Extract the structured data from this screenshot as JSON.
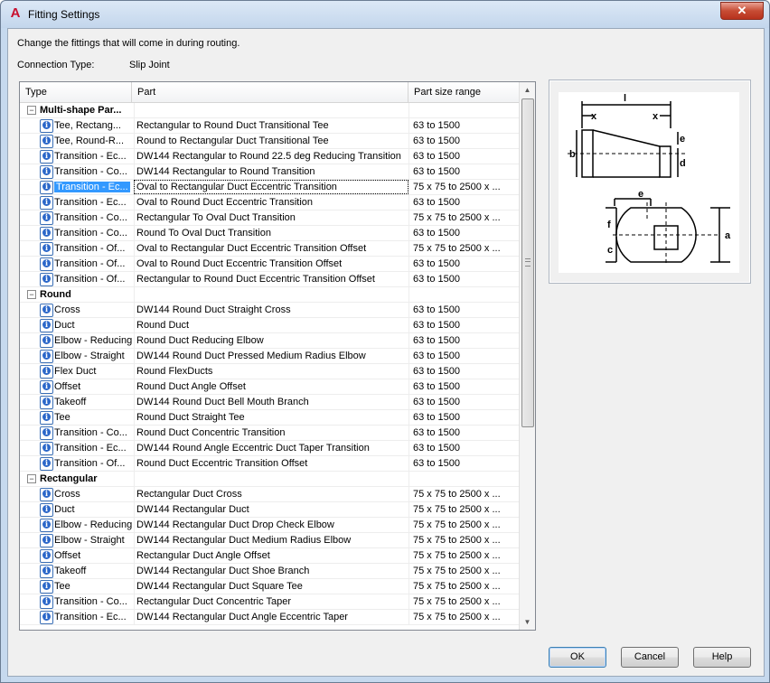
{
  "window": {
    "title": "Fitting Settings",
    "close_glyph": "✕"
  },
  "description": "Change the fittings that will come in during routing.",
  "connection": {
    "label": "Connection Type:",
    "value": "Slip Joint"
  },
  "columns": [
    "Type",
    "Part",
    "Part size range"
  ],
  "rows": [
    {
      "kind": "group",
      "type": "Multi-shape Par..."
    },
    {
      "kind": "item",
      "type": "Tee, Rectang...",
      "part": "Rectangular to Round Duct Transitional Tee",
      "size": "63 to 1500"
    },
    {
      "kind": "item",
      "type": "Tee, Round-R...",
      "part": "Round to Rectangular Duct Transitional Tee",
      "size": "63 to 1500"
    },
    {
      "kind": "item",
      "type": "Transition - Ec...",
      "part": "DW144 Rectangular to Round 22.5 deg Reducing Transition",
      "size": "63 to 1500"
    },
    {
      "kind": "item",
      "type": "Transition - Co...",
      "part": "DW144 Rectangular to Round Transition",
      "size": "63 to 1500"
    },
    {
      "kind": "item",
      "type": "Transition - Ec...",
      "part": "Oval to Rectangular Duct Eccentric Transition",
      "size": "75 x 75 to 2500 x ...",
      "selected": true
    },
    {
      "kind": "item",
      "type": "Transition - Ec...",
      "part": "Oval to Round Duct Eccentric Transition",
      "size": "63 to 1500"
    },
    {
      "kind": "item",
      "type": "Transition - Co...",
      "part": "Rectangular To Oval Duct Transition",
      "size": "75 x 75 to 2500 x ..."
    },
    {
      "kind": "item",
      "type": "Transition - Co...",
      "part": "Round To Oval Duct Transition",
      "size": "63 to 1500"
    },
    {
      "kind": "item",
      "type": "Transition - Of...",
      "part": "Oval to Rectangular Duct Eccentric Transition Offset",
      "size": "75 x 75 to 2500 x ..."
    },
    {
      "kind": "item",
      "type": "Transition - Of...",
      "part": "Oval to Round Duct Eccentric Transition Offset",
      "size": "63 to 1500"
    },
    {
      "kind": "item",
      "type": "Transition - Of...",
      "part": "Rectangular to Round Duct Eccentric Transition Offset",
      "size": "63 to 1500"
    },
    {
      "kind": "group",
      "type": "Round"
    },
    {
      "kind": "item",
      "type": "Cross",
      "part": "DW144 Round Duct Straight Cross",
      "size": "63 to 1500"
    },
    {
      "kind": "item",
      "type": "Duct",
      "part": "Round Duct",
      "size": "63 to 1500"
    },
    {
      "kind": "item",
      "type": "Elbow - Reducing",
      "part": "Round Duct Reducing Elbow",
      "size": "63 to 1500"
    },
    {
      "kind": "item",
      "type": "Elbow - Straight",
      "part": "DW144 Round Duct Pressed Medium Radius Elbow",
      "size": "63 to 1500"
    },
    {
      "kind": "item",
      "type": "Flex Duct",
      "part": "Round FlexDucts",
      "size": "63 to 1500"
    },
    {
      "kind": "item",
      "type": "Offset",
      "part": "Round Duct Angle Offset",
      "size": "63 to 1500"
    },
    {
      "kind": "item",
      "type": "Takeoff",
      "part": "DW144 Round Duct Bell Mouth Branch",
      "size": "63 to 1500"
    },
    {
      "kind": "item",
      "type": "Tee",
      "part": "Round Duct Straight Tee",
      "size": "63 to 1500"
    },
    {
      "kind": "item",
      "type": "Transition - Co...",
      "part": "Round Duct Concentric Transition",
      "size": "63 to 1500"
    },
    {
      "kind": "item",
      "type": "Transition - Ec...",
      "part": "DW144 Round Angle Eccentric Duct Taper Transition",
      "size": "63 to 1500"
    },
    {
      "kind": "item",
      "type": "Transition - Of...",
      "part": "Round Duct Eccentric Transition Offset",
      "size": "63 to 1500"
    },
    {
      "kind": "group",
      "type": "Rectangular"
    },
    {
      "kind": "item",
      "type": "Cross",
      "part": "Rectangular Duct Cross",
      "size": "75 x 75 to 2500 x ..."
    },
    {
      "kind": "item",
      "type": "Duct",
      "part": "DW144 Rectangular Duct",
      "size": "75 x 75 to 2500 x ..."
    },
    {
      "kind": "item",
      "type": "Elbow - Reducing",
      "part": "DW144 Rectangular Duct Drop Check Elbow",
      "size": "75 x 75 to 2500 x ..."
    },
    {
      "kind": "item",
      "type": "Elbow - Straight",
      "part": "DW144 Rectangular Duct Medium Radius Elbow",
      "size": "75 x 75 to 2500 x ..."
    },
    {
      "kind": "item",
      "type": "Offset",
      "part": "Rectangular Duct Angle Offset",
      "size": "75 x 75 to 2500 x ..."
    },
    {
      "kind": "item",
      "type": "Takeoff",
      "part": "DW144 Rectangular Duct Shoe Branch",
      "size": "75 x 75 to 2500 x ..."
    },
    {
      "kind": "item",
      "type": "Tee",
      "part": "DW144 Rectangular Duct Square Tee",
      "size": "75 x 75 to 2500 x ..."
    },
    {
      "kind": "item",
      "type": "Transition - Co...",
      "part": "Rectangular Duct Concentric Taper",
      "size": "75 x 75 to 2500 x ..."
    },
    {
      "kind": "item",
      "type": "Transition - Ec...",
      "part": "DW144 Rectangular Duct Angle Eccentric Taper",
      "size": "75 x 75 to 2500 x ..."
    }
  ],
  "preview": {
    "labels": {
      "l": "l",
      "x1": "x",
      "x2": "x",
      "b": "b",
      "e": "e",
      "d": "d",
      "e2": "e",
      "f": "f",
      "c": "c",
      "a": "a"
    }
  },
  "buttons": {
    "ok": "OK",
    "cancel": "Cancel",
    "help": "Help"
  },
  "colors": {
    "selection": "#3399ff",
    "info_icon": "#2b67c9",
    "app_icon": "#c8102e"
  }
}
